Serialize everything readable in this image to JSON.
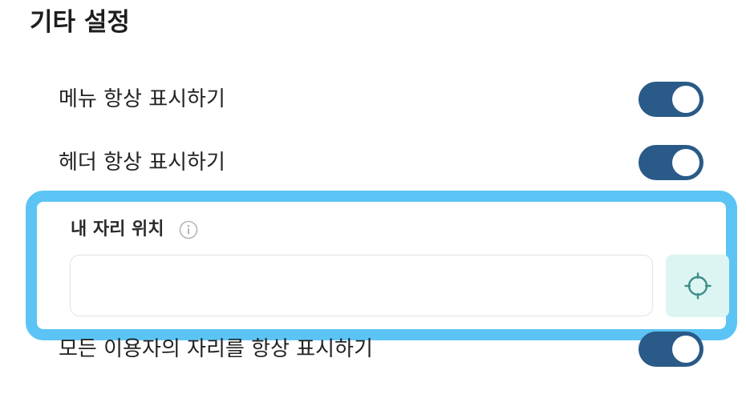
{
  "section": {
    "title": "기타 설정"
  },
  "settings": {
    "menu": {
      "label": "메뉴 항상 표시하기",
      "enabled": true
    },
    "header": {
      "label": "헤더 항상 표시하기",
      "enabled": true
    },
    "everyone_location": {
      "label": "모든 이용자의 자리를 항상 표시하기",
      "enabled": true
    }
  },
  "location": {
    "label": "내 자리 위치",
    "value": "",
    "placeholder": ""
  },
  "icons": {
    "info": "info-circle-icon",
    "locate": "crosshair-icon"
  },
  "colors": {
    "toggle_on": "#2a5a87",
    "highlight_border": "#5cc4f5",
    "locate_button_bg": "#dcf5f3",
    "locate_icon": "#3f8d89",
    "info_icon": "#b5b5b5"
  }
}
